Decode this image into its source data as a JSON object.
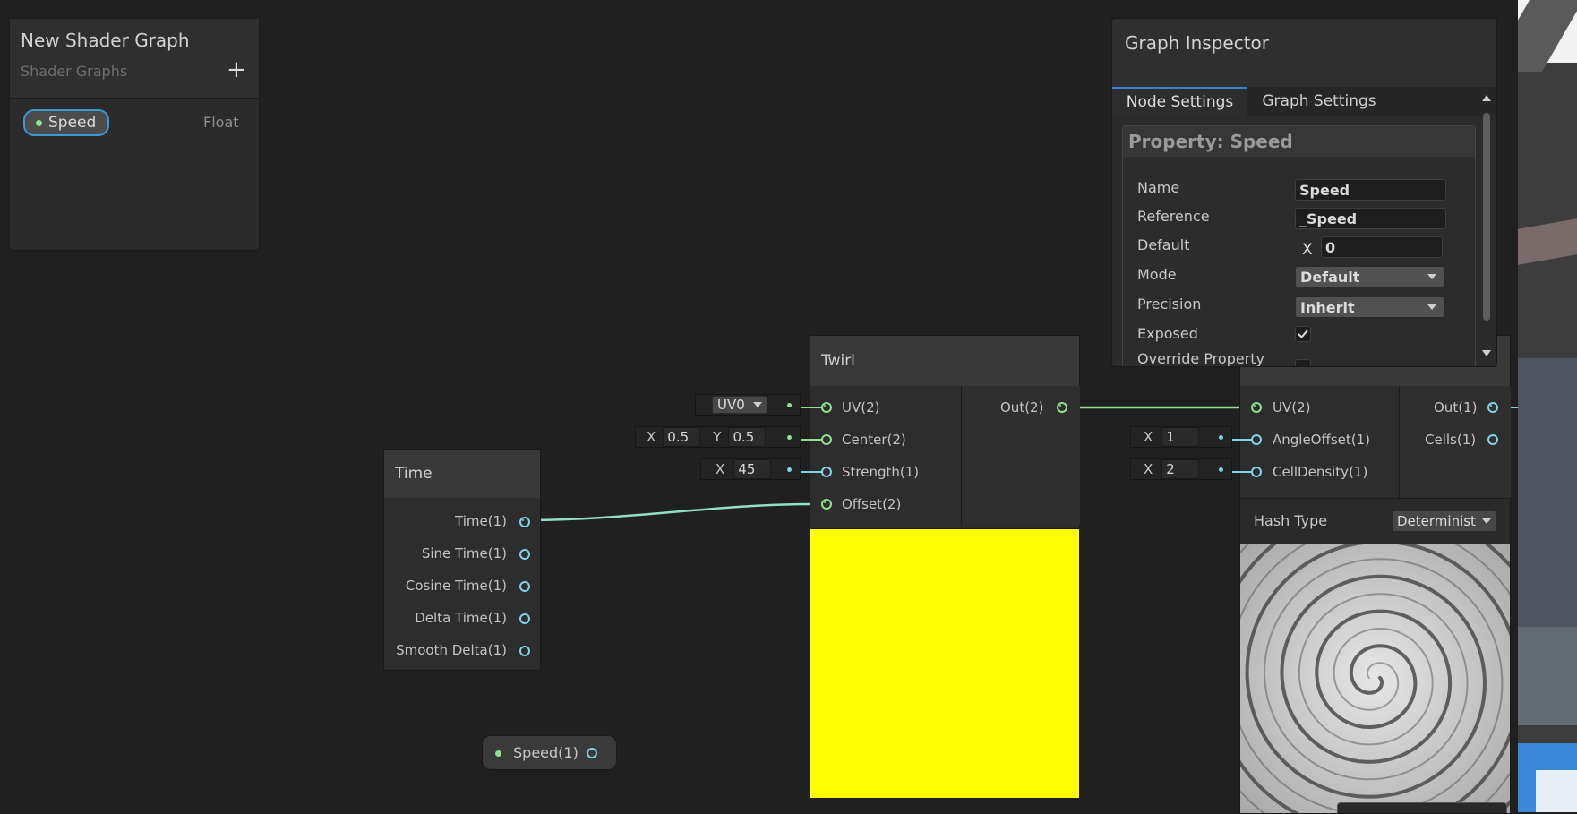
{
  "blackboard": {
    "title": "New Shader Graph",
    "subtitle": "Shader Graphs",
    "add_glyph": "+",
    "property": {
      "name": "Speed",
      "type": "Float"
    }
  },
  "inspector": {
    "title": "Graph Inspector",
    "tabs": [
      "Node Settings",
      "Graph Settings"
    ],
    "section_title": "Property: Speed",
    "labels": {
      "name": "Name",
      "reference": "Reference",
      "default": "Default",
      "mode": "Mode",
      "precision": "Precision",
      "exposed": "Exposed",
      "override": "Override Property"
    },
    "values": {
      "name": "Speed",
      "reference": "_Speed",
      "default_axis": "X",
      "default": "0",
      "mode": "Default",
      "precision": "Inherit",
      "exposed": true,
      "override": false
    }
  },
  "time_node": {
    "title": "Time",
    "outputs": [
      "Time(1)",
      "Sine Time(1)",
      "Cosine Time(1)",
      "Delta Time(1)",
      "Smooth Delta(1)"
    ]
  },
  "twirl_node": {
    "title": "Twirl",
    "inputs": [
      "UV(2)",
      "Center(2)",
      "Strength(1)",
      "Offset(2)"
    ],
    "output": "Out(2)",
    "uv_channel": "UV0",
    "center": {
      "x_label": "X",
      "x": "0.5",
      "y_label": "Y",
      "y": "0.5"
    },
    "strength": {
      "x_label": "X",
      "x": "45"
    },
    "preview_color": "#ffff00"
  },
  "voronoi_node": {
    "inputs": [
      "UV(2)",
      "AngleOffset(1)",
      "CellDensity(1)"
    ],
    "outputs": [
      "Out(1)",
      "Cells(1)"
    ],
    "angle_offset": {
      "x_label": "X",
      "x": "1"
    },
    "cell_density": {
      "x_label": "X",
      "x": "2"
    },
    "hash_type_label": "Hash Type",
    "hash_type": "Determinist"
  },
  "speed_node": {
    "label": "Speed(1)"
  },
  "colors": {
    "vector_port": "#8fe08f",
    "float_port": "#7fd5e8",
    "selection": "#3a99d8"
  }
}
